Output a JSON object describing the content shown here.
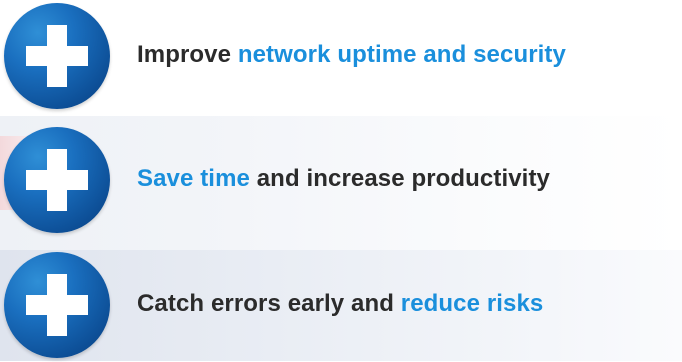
{
  "colors": {
    "highlight": "#1a8fdc",
    "text": "#2b2b2b",
    "icon_blue": "#1a6fbf"
  },
  "items": [
    {
      "icon": "plus-icon",
      "text_before": "Improve ",
      "highlight": "network uptime and security",
      "text_after": ""
    },
    {
      "icon": "plus-icon",
      "text_before": "",
      "highlight": "Save time",
      "text_after": " and increase productivity"
    },
    {
      "icon": "plus-icon",
      "text_before": "Catch errors early and ",
      "highlight": "reduce risks",
      "text_after": ""
    }
  ]
}
